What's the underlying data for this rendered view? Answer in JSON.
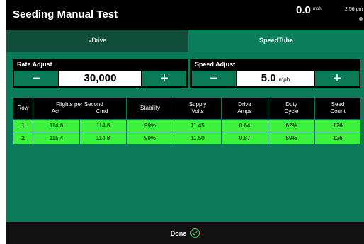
{
  "header": {
    "title": "Seeding Manual Test",
    "speed_value": "0.0",
    "speed_unit": "mph",
    "time": "2:56 pm"
  },
  "tabs": [
    {
      "label": "vDrive",
      "active": false
    },
    {
      "label": "SpeedTube",
      "active": true
    }
  ],
  "rate_adjust": {
    "label": "Rate Adjust",
    "value": "30,000",
    "minus": "−",
    "plus": "+"
  },
  "speed_adjust": {
    "label": "Speed Adjust",
    "value": "5.0",
    "unit": "mph",
    "minus": "−",
    "plus": "+"
  },
  "table": {
    "headers": {
      "row": "Row",
      "fps": "Flights per Second",
      "act": "Act",
      "cmd": "Cmd",
      "stability": "Stability",
      "supply_volts_1": "Supply",
      "supply_volts_2": "Volts",
      "drive_amps_1": "Drive",
      "drive_amps_2": "Amps",
      "duty_cycle_1": "Duty",
      "duty_cycle_2": "Cycle",
      "seed_count_1": "Seed",
      "seed_count_2": "Count"
    },
    "rows": [
      {
        "row": "1",
        "act": "114.6",
        "cmd": "114.8",
        "stability": "99%",
        "volts": "11.45",
        "amps": "0.84",
        "duty": "62%",
        "seed": "126"
      },
      {
        "row": "2",
        "act": "115.4",
        "cmd": "114.8",
        "stability": "99%",
        "volts": "11.50",
        "amps": "0.87",
        "duty": "59%",
        "seed": "126"
      }
    ]
  },
  "footer": {
    "done_label": "Done"
  },
  "colors": {
    "background_green": "#0a7a59",
    "row_green": "#3cf23c",
    "header_black": "#000000"
  }
}
